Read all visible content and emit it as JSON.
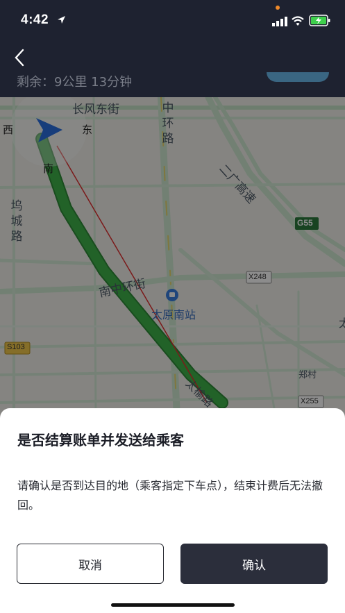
{
  "status": {
    "time": "4:42"
  },
  "nav": {
    "remaining": "剩余：9公里  13分钟"
  },
  "map": {
    "labels": {
      "changfeng": "长风东街",
      "zhonghuan": [
        "中",
        "环",
        "路"
      ],
      "erguang": "二广高速",
      "wucheng": [
        "坞",
        "城",
        "路"
      ],
      "nanzhonghuan": "南中环街",
      "taiyuan_south": "太原南站",
      "taiyu": "太榆路",
      "zhengcun": "郑村",
      "g55": "G55",
      "x248": "X248",
      "x255": "X255",
      "s103": "S103",
      "compass_w": "西",
      "compass_e": "东",
      "compass_s": "南",
      "edge_tai": "太"
    },
    "colors": {
      "route": "#3fb24a",
      "route_edge": "#2e8a37",
      "red_line": "#e03030",
      "road": "#d4ecd6",
      "road_edge": "#b9dcbd"
    }
  },
  "dialog": {
    "title": "是否结算账单并发送给乘客",
    "body": "请确认是否到达目的地（乘客指定下车点），结束计费后无法撤回。",
    "cancel": "取消",
    "confirm": "确认"
  },
  "icons": {
    "back": "chevron-left-icon",
    "signal": "signal-icon",
    "wifi": "wifi-icon",
    "battery": "battery-charging-icon",
    "location": "location-arrow-icon",
    "nav_arrow": "navigation-arrow-icon",
    "station": "train-station-icon"
  }
}
